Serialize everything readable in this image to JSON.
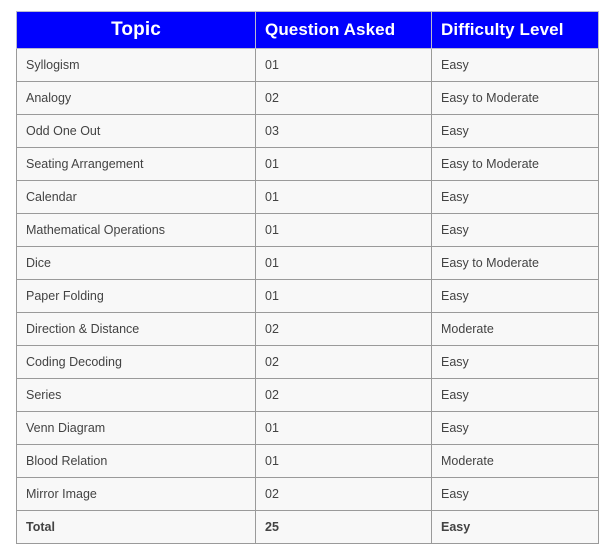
{
  "table": {
    "header": {
      "topic": "Topic",
      "question_asked": "Question Asked",
      "difficulty_level": "Difficulty Level"
    },
    "colors": {
      "header_background": "#0000fe",
      "header_text": "#ffffff",
      "cell_background": "#f8f8f8",
      "cell_text": "#434343",
      "cell_border": "#9a9a9a",
      "page_background": "#ffffff"
    },
    "rows": [
      {
        "topic": "Syllogism",
        "question_asked": "01",
        "difficulty_level": "Easy"
      },
      {
        "topic": "Analogy",
        "question_asked": "02",
        "difficulty_level": "Easy to Moderate"
      },
      {
        "topic": "Odd One Out",
        "question_asked": "03",
        "difficulty_level": "Easy"
      },
      {
        "topic": "Seating Arrangement",
        "question_asked": "01",
        "difficulty_level": "Easy to Moderate"
      },
      {
        "topic": "Calendar",
        "question_asked": "01",
        "difficulty_level": "Easy"
      },
      {
        "topic": "Mathematical Operations",
        "question_asked": "01",
        "difficulty_level": "Easy"
      },
      {
        "topic": "Dice",
        "question_asked": "01",
        "difficulty_level": "Easy to Moderate"
      },
      {
        "topic": "Paper Folding",
        "question_asked": "01",
        "difficulty_level": "Easy"
      },
      {
        "topic": "Direction & Distance",
        "question_asked": "02",
        "difficulty_level": "Moderate"
      },
      {
        "topic": "Coding Decoding",
        "question_asked": "02",
        "difficulty_level": "Easy"
      },
      {
        "topic": "Series",
        "question_asked": "02",
        "difficulty_level": "Easy"
      },
      {
        "topic": "Venn Diagram",
        "question_asked": "01",
        "difficulty_level": "Easy"
      },
      {
        "topic": "Blood Relation",
        "question_asked": "01",
        "difficulty_level": "Moderate"
      },
      {
        "topic": "Mirror Image",
        "question_asked": "02",
        "difficulty_level": "Easy"
      }
    ],
    "total_row": {
      "topic": "Total",
      "question_asked": "25",
      "difficulty_level": "Easy"
    }
  }
}
